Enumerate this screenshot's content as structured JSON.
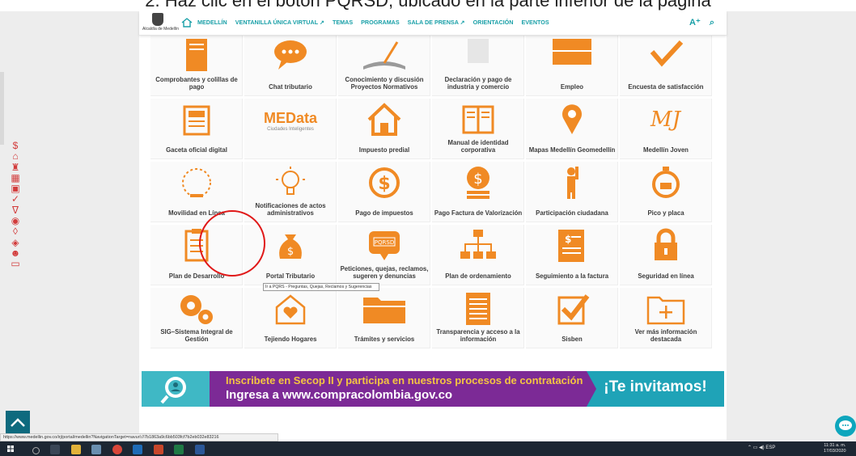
{
  "caption": "2.   Haz clic en el botón PQRSD, ubicado en la parte inferior de la página",
  "header": {
    "logo_text": "Alcaldía de Medellín",
    "nav_items": [
      "MEDELLÍN",
      "VENTANILLA ÚNICA VIRTUAL ↗",
      "TEMAS",
      "PROGRAMAS",
      "SALA DE PRENSA ↗",
      "ORIENTACIÓN",
      "EVENTOS"
    ],
    "font_size_tool": "A⁺",
    "search_icon": "search-icon"
  },
  "tiles": [
    {
      "label": "Comprobantes y colillas de pago",
      "icon": "receipt-icon"
    },
    {
      "label": "Chat tributario",
      "icon": "chat-bubble-icon"
    },
    {
      "label": "Conocimiento y discusión Proyectos Normativos",
      "icon": "open-book-icon"
    },
    {
      "label": "Declaración y pago de industria y comercio",
      "icon": "document-icon"
    },
    {
      "label": "Empleo",
      "icon": "briefcase-icon"
    },
    {
      "label": "Encuesta de satisfacción",
      "icon": "checkmark-icon"
    },
    {
      "label": "Gaceta oficial digital",
      "icon": "newspaper-icon"
    },
    {
      "label": "",
      "icon": "medata-logo",
      "logo": "MEData",
      "logo_sub": "Ciudades Inteligentes"
    },
    {
      "label": "Impuesto predial",
      "icon": "house-icon"
    },
    {
      "label": "Manual de identidad corporativa",
      "icon": "manual-icon"
    },
    {
      "label": "Mapas Medellín Geomedellín",
      "icon": "map-pin-icon"
    },
    {
      "label": "Medellín Joven",
      "icon": "mj-logo-icon"
    },
    {
      "label": "Movilidad en Línea",
      "icon": "mobility-icon"
    },
    {
      "label": "Notificaciones de actos administrativos",
      "icon": "lightbulb-icon"
    },
    {
      "label": "Pago de impuestos",
      "icon": "dollar-coin-icon"
    },
    {
      "label": "Pago Factura de Valorización",
      "icon": "coin-stack-icon"
    },
    {
      "label": "Participación ciudadana",
      "icon": "person-raised-hand-icon"
    },
    {
      "label": "Pico y placa",
      "icon": "stopwatch-car-icon"
    },
    {
      "label": "Plan de Desarrollo",
      "icon": "clipboard-icon"
    },
    {
      "label": "Portal Tributario",
      "icon": "money-bag-icon"
    },
    {
      "label": "Peticiones, quejas, reclamos, sugeren y denuncias",
      "icon": "pqrsd-chat-icon",
      "badge": "PQRSD"
    },
    {
      "label": "Plan de ordenamiento",
      "icon": "org-chart-icon"
    },
    {
      "label": "Seguimiento a la factura",
      "icon": "invoice-icon"
    },
    {
      "label": "Seguridad en línea",
      "icon": "padlock-icon"
    },
    {
      "label": "SIG–Sistema Integral de Gestión",
      "icon": "gears-icon"
    },
    {
      "label": "Tejiendo Hogares",
      "icon": "heart-house-icon"
    },
    {
      "label": "Trámites y servicios",
      "icon": "folder-icon"
    },
    {
      "label": "Transparencia y acceso a la información",
      "icon": "document-lines-icon"
    },
    {
      "label": "Sisben",
      "icon": "checkbox-icon"
    },
    {
      "label": "Ver más información destacada",
      "icon": "folder-plus-icon"
    }
  ],
  "tooltip": "Ir a PQRS - Preguntas, Quejas, Reclamos y Sugerencias",
  "banner": {
    "line1": "Inscribete en Secop II y participa en nuestros procesos de contratación",
    "line2": "Ingresa a www.compracolombia.gov.co",
    "cta": "¡Te invitamos!"
  },
  "status_url": "https://www.medellin.gov.co/irj/portal/medellin?NavigationTarget=navurl://7b1863a9c6bb503fcf7b2eb032e83216",
  "taskbar": {
    "tray": "ESP",
    "time": "11:31 a. m.",
    "date": "17/03/2020"
  },
  "colors": {
    "accent": "#f08a24",
    "nav": "#1aa0a8",
    "banner_purple": "#7c2a96",
    "banner_teal": "#1fa3b7",
    "highlight": "#e01818"
  }
}
